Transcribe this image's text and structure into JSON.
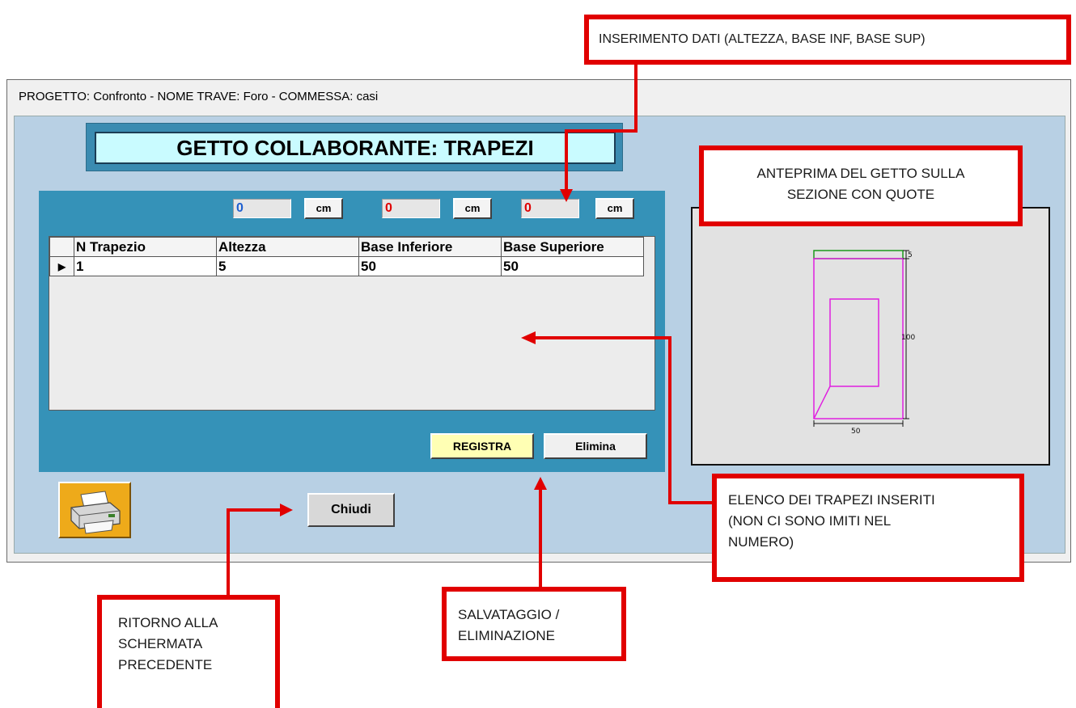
{
  "window": {
    "title": "PROGETTO: Confronto - NOME TRAVE: Foro - COMMESSA: casi"
  },
  "form": {
    "heading": "GETTO COLLABORANTE: TRAPEZI",
    "inputs": [
      {
        "value": "0",
        "unit": "cm",
        "color": "#1e5fd0"
      },
      {
        "value": "0",
        "unit": "cm",
        "color": "#e00000"
      },
      {
        "value": "0",
        "unit": "cm",
        "color": "#e00000"
      }
    ],
    "table": {
      "columns": [
        "N Trapezio",
        "Altezza",
        "Base Inferiore",
        "Base Superiore"
      ],
      "rows": [
        {
          "cells": [
            "1",
            "5",
            "50",
            "50"
          ]
        }
      ]
    },
    "buttons": {
      "registra": "REGISTRA",
      "elimina": "Elimina",
      "chiudi": "Chiudi"
    },
    "print_icon": "printer-icon"
  },
  "preview": {
    "dimension_top": "5",
    "dimension_right": "100",
    "dimension_bottom": "50"
  },
  "annotations": {
    "inserimento": "INSERIMENTO DATI (ALTEZZA, BASE INF, BASE SUP)",
    "anteprima": [
      "ANTEPRIMA DEL GETTO SULLA",
      "SEZIONE CON QUOTE"
    ],
    "elenco": [
      "ELENCO  DEI TRAPEZI INSERITI",
      "(NON  CI  SONO  IMITI  NEL",
      "NUMERO)"
    ],
    "salvataggio": [
      "SALVATAGGIO  /",
      "ELIMINAZIONE"
    ],
    "ritorno": [
      "RITORNO    ALLA",
      "SCHERMATA",
      "PRECEDENTE"
    ]
  },
  "colors": {
    "annotation_red": "#e10000",
    "panel_blue": "#3592b8",
    "client_bg": "#b8d0e4"
  }
}
